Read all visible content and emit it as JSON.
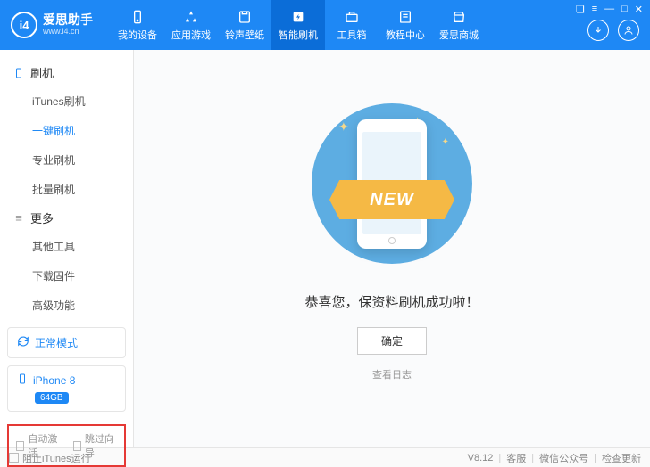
{
  "app": {
    "name": "爱思助手",
    "url": "www.i4.cn",
    "logo_text": "i4"
  },
  "window_controls": [
    "❏",
    "≡",
    "—",
    "□",
    "✕"
  ],
  "top_nav": [
    {
      "label": "我的设备",
      "icon": "phone"
    },
    {
      "label": "应用游戏",
      "icon": "apps"
    },
    {
      "label": "铃声壁纸",
      "icon": "music"
    },
    {
      "label": "智能刷机",
      "icon": "flash",
      "active": true
    },
    {
      "label": "工具箱",
      "icon": "toolbox"
    },
    {
      "label": "教程中心",
      "icon": "book"
    },
    {
      "label": "爱思商城",
      "icon": "shop"
    }
  ],
  "sidebar": {
    "sections": [
      {
        "title": "刷机",
        "items": [
          "iTunes刷机",
          "一键刷机",
          "专业刷机",
          "批量刷机"
        ],
        "active_index": 1
      },
      {
        "title": "更多",
        "items": [
          "其他工具",
          "下载固件",
          "高级功能"
        ]
      }
    ],
    "status_mode": "正常模式",
    "device": {
      "name": "iPhone 8",
      "storage": "64GB"
    },
    "checkboxes": [
      "自动激活",
      "跳过向导"
    ]
  },
  "main": {
    "ribbon_text": "NEW",
    "success_message": "恭喜您，保资料刷机成功啦！",
    "confirm_button": "确定",
    "view_log": "查看日志"
  },
  "footer": {
    "checkbox": "阻止iTunes运行",
    "version": "V8.12",
    "links": [
      "客服",
      "微信公众号",
      "检查更新"
    ]
  }
}
